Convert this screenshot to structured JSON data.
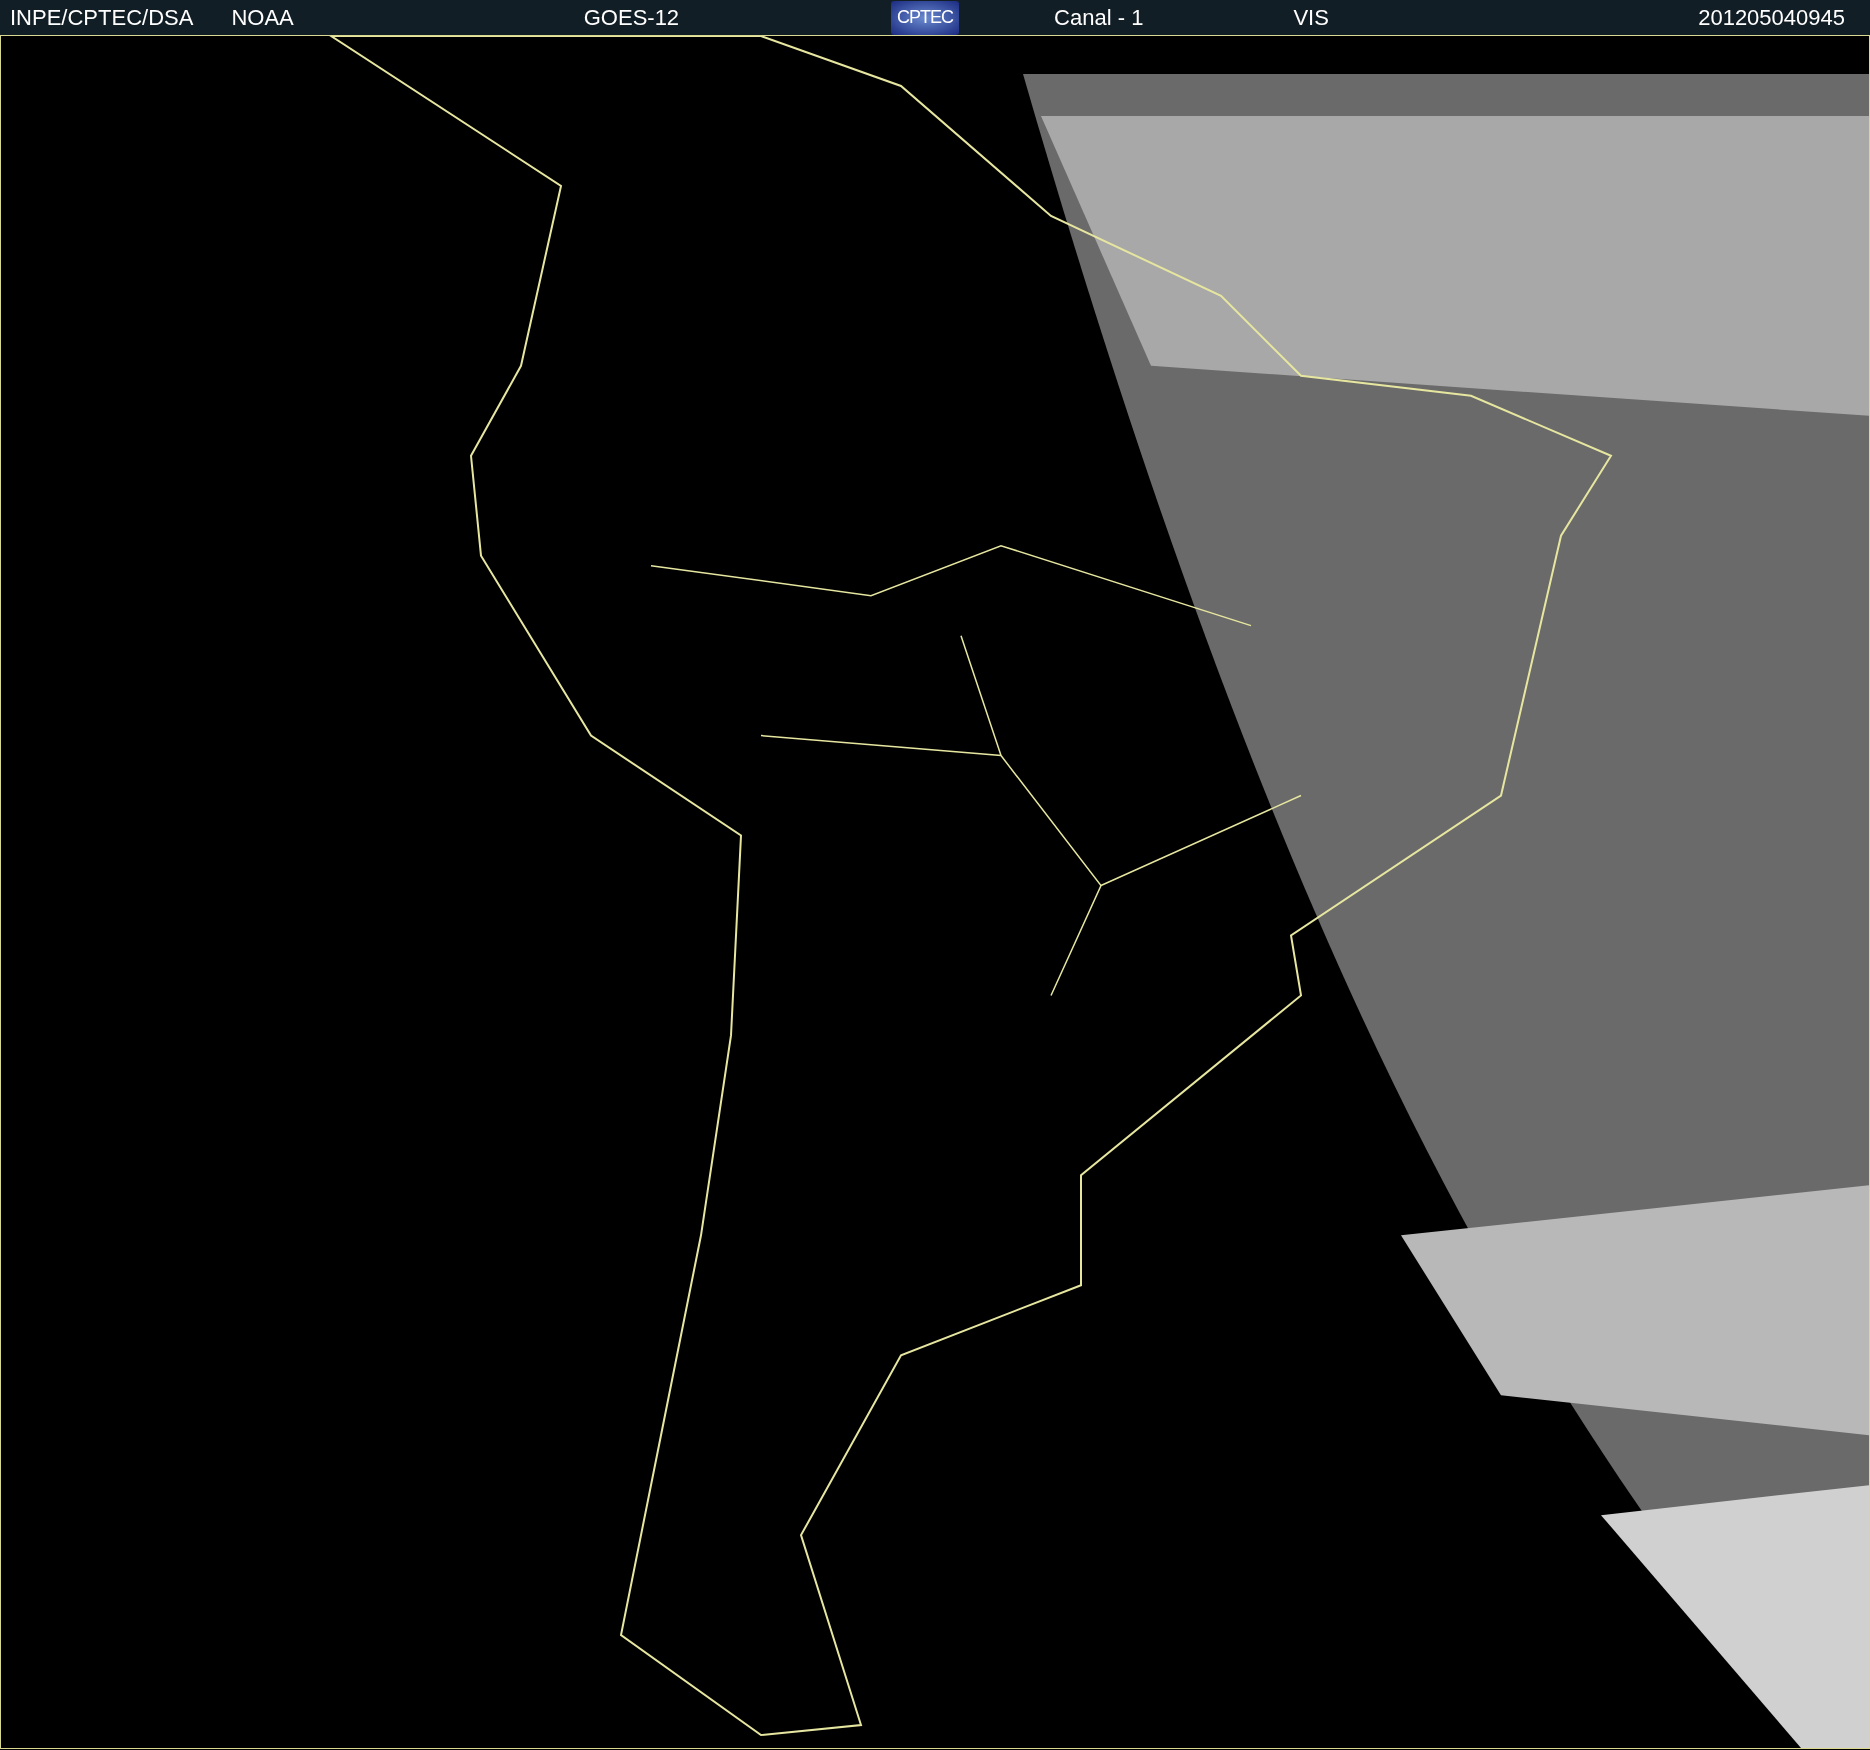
{
  "header": {
    "items": [
      {
        "text": "INPE/CPTEC/DSA"
      },
      {
        "text": "NOAA"
      },
      {
        "text": "GOES-12"
      },
      {
        "kind": "logo",
        "text": "CPTEC"
      },
      {
        "text": "Canal - 1"
      },
      {
        "text": "VIS"
      },
      {
        "text": "201205040945"
      }
    ]
  }
}
